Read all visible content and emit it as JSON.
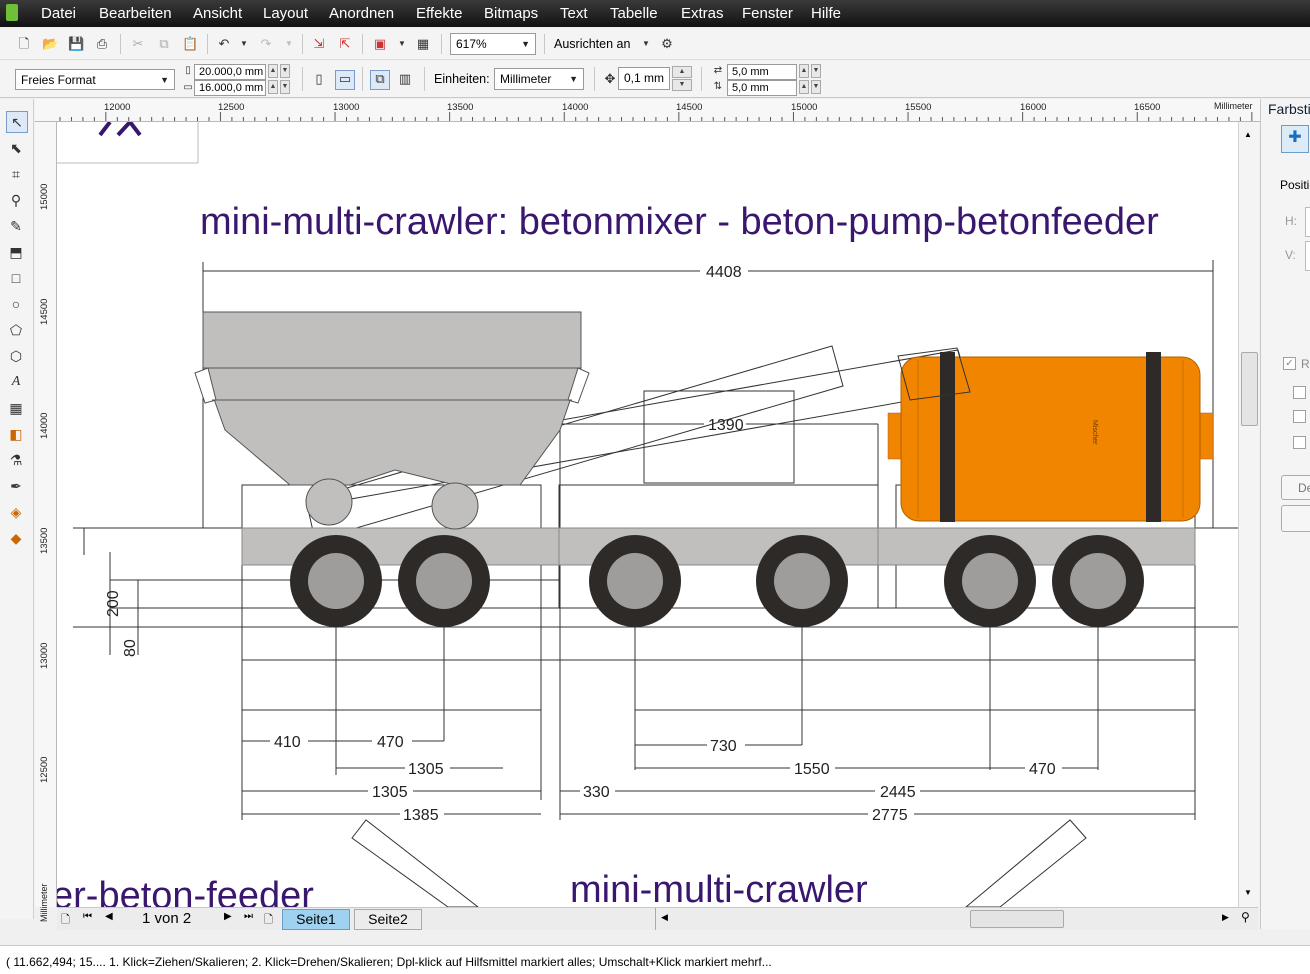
{
  "menubar": {
    "items": [
      "Datei",
      "Bearbeiten",
      "Ansicht",
      "Layout",
      "Anordnen",
      "Effekte",
      "Bitmaps",
      "Text",
      "Tabelle",
      "Extras",
      "Fenster",
      "Hilfe"
    ]
  },
  "toolbar": {
    "zoom": "617%",
    "snap_label": "Ausrichten an"
  },
  "propertybar": {
    "page_format": "Freies Format",
    "width": "20.000,0 mm",
    "height": "16.000,0 mm",
    "units_label": "Einheiten:",
    "units_value": "Millimeter",
    "nudge": "0,1 mm",
    "dup_x": "5,0 mm",
    "dup_y": "5,0 mm"
  },
  "ruler": {
    "unit": "Millimeter",
    "h_ticks": [
      "12000",
      "12500",
      "13000",
      "13500",
      "14000",
      "14500",
      "15000",
      "15500",
      "16000",
      "16500"
    ],
    "v_ticks": [
      "15000",
      "14500",
      "14000",
      "13500",
      "13000",
      "12500"
    ]
  },
  "drawing": {
    "title": "mini-multi-crawler: betonmixer - beton-pump-betonfeeder",
    "lower_title": "mini-multi-crawler",
    "left_text": "er-beton-feeder",
    "tank_label": "Mischer",
    "dims": {
      "overall": "4408",
      "conveyor": "1390",
      "h200": "200",
      "h80": "80",
      "d410": "410",
      "d470a": "470",
      "d1305a": "1305",
      "d1305b": "1305",
      "d1385": "1385",
      "d730": "730",
      "d1550": "1550",
      "d470b": "470",
      "d330": "330",
      "d2445": "2445",
      "d2775": "2775"
    }
  },
  "colors": {
    "tank": "#f28500",
    "hopper": "#c0bfbd",
    "tire": "#2e2a28",
    "rim": "#9e9d9b",
    "title": "#3a176e"
  },
  "pagenav": {
    "counter": "1 von 2",
    "tabs": [
      "Seite1",
      "Seite2"
    ]
  },
  "docker": {
    "title": "Farbstil",
    "position_label": "Positi",
    "h_label": "H:",
    "v_label": "V:",
    "check_label": "R",
    "button_label": "De"
  },
  "status": {
    "text": "( 11.662,494; 15.... 1. Klick=Ziehen/Skalieren; 2. Klick=Drehen/Skalieren; Dpl-klick auf Hilfsmittel markiert alles; Umschalt+Klick markiert mehrf..."
  }
}
